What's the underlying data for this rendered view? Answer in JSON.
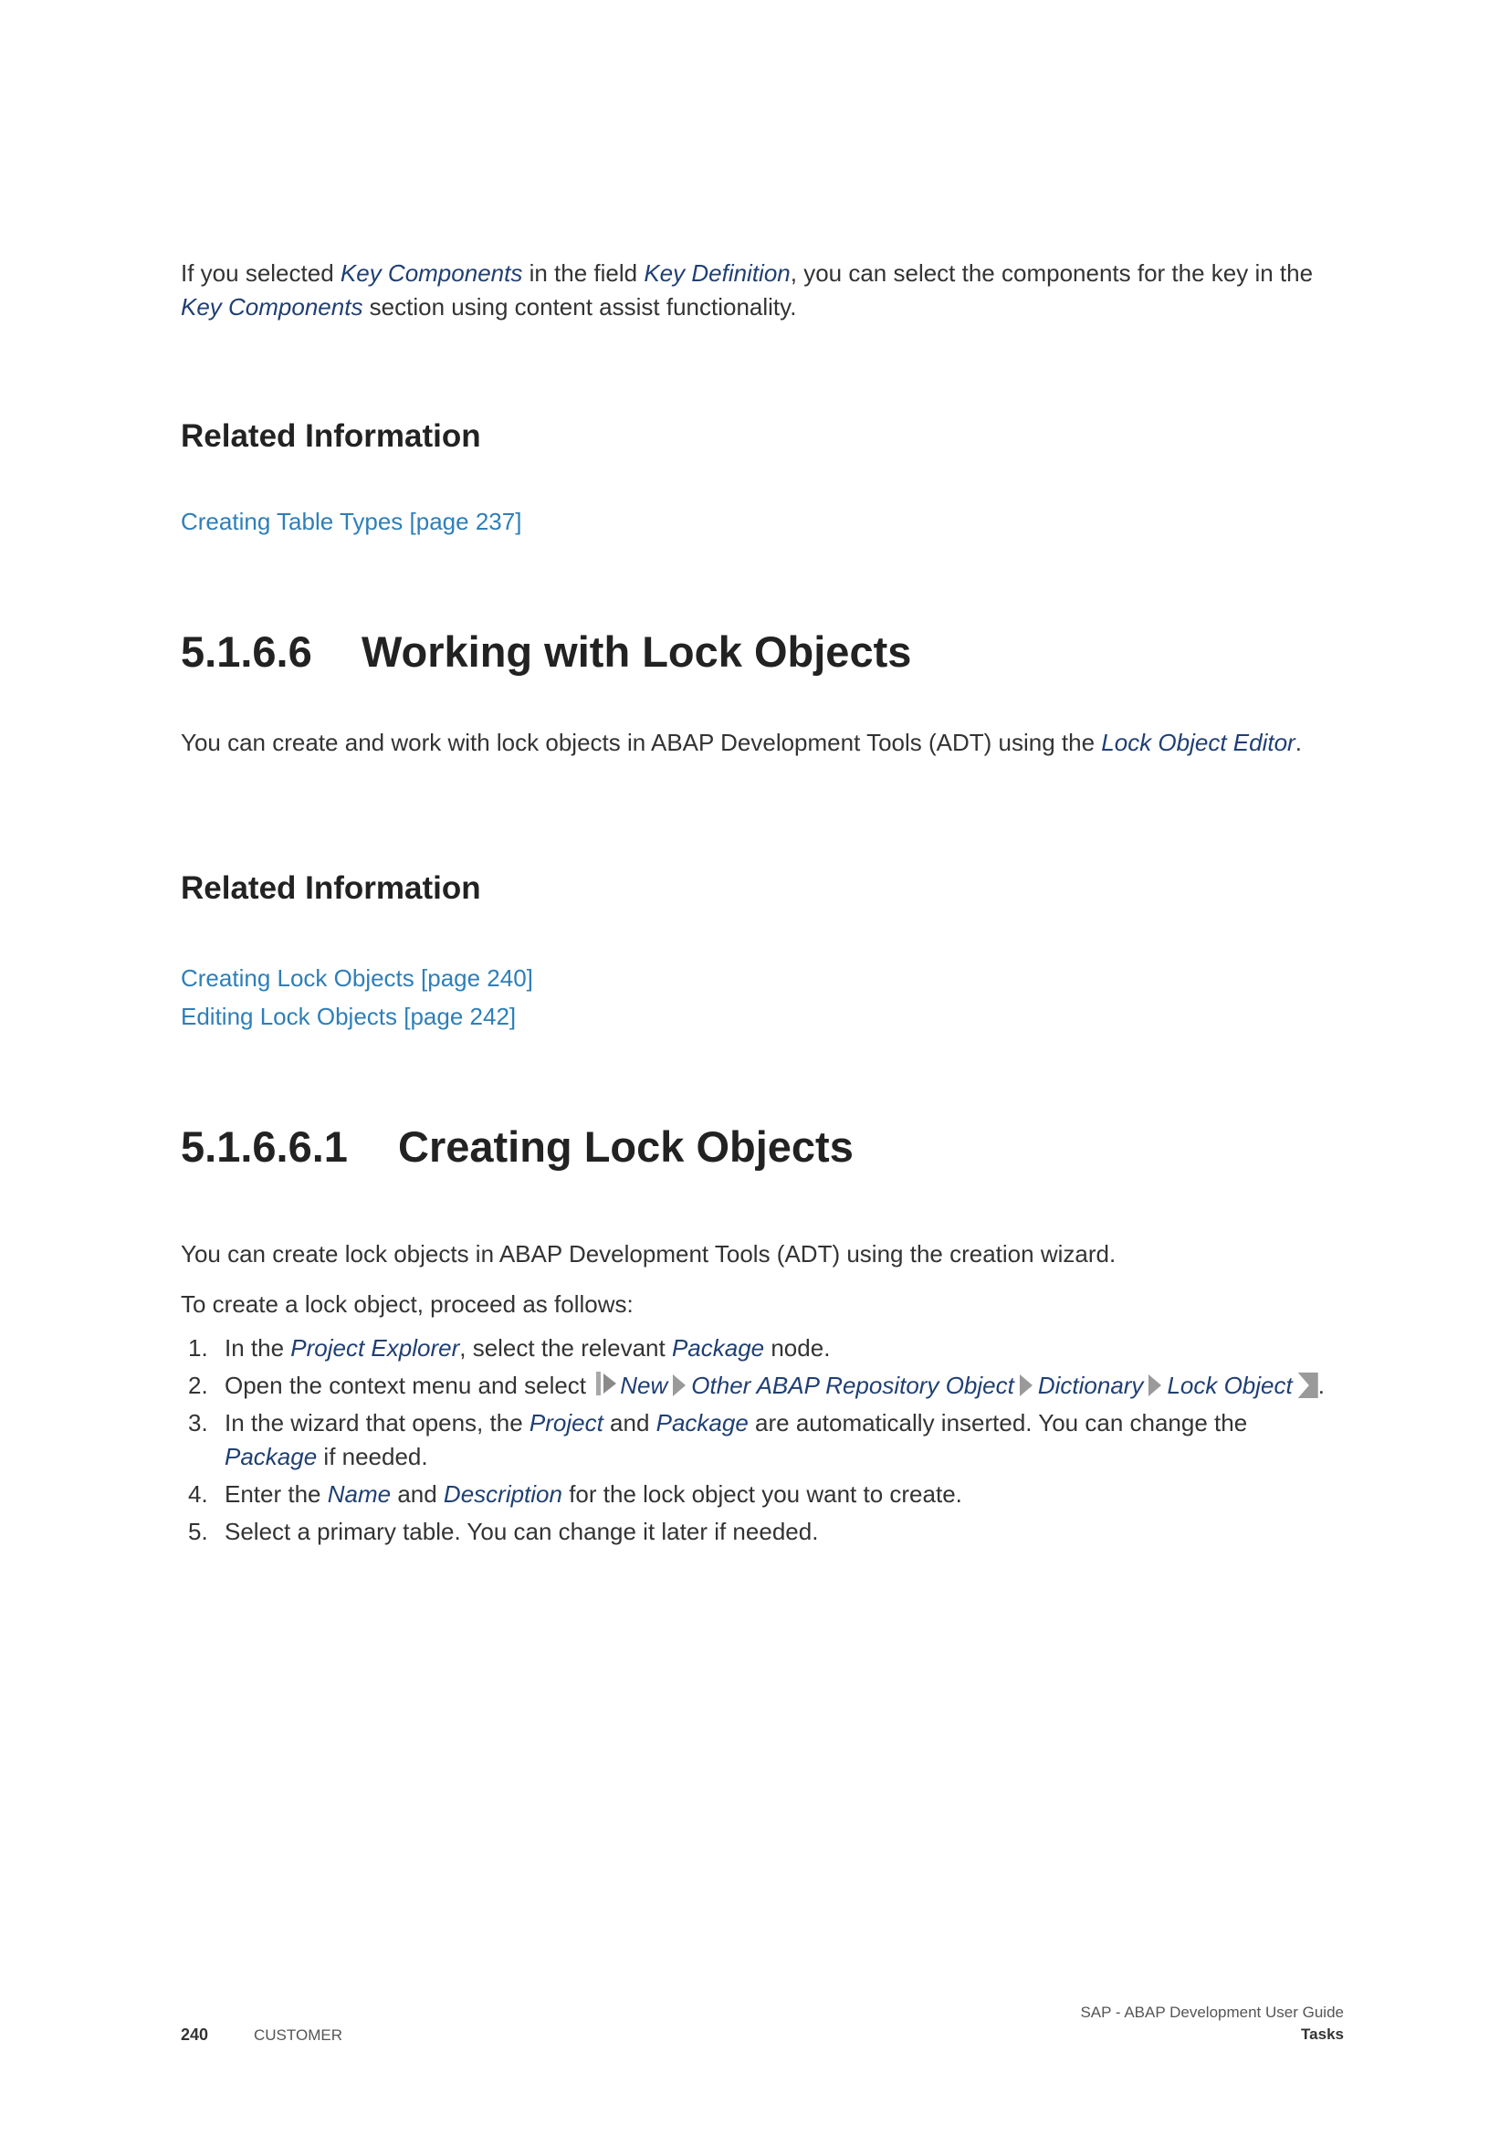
{
  "intro": {
    "t1": "If you selected ",
    "term1": "Key Components",
    "t2": " in the field ",
    "term2": "Key Definition",
    "t3": ", you can select the components for the key in the ",
    "term3": "Key Components",
    "t4": " section using content assist functionality."
  },
  "related1": {
    "heading": "Related Information",
    "links": [
      "Creating Table Types [page 237]"
    ]
  },
  "section1": {
    "number": "5.1.6.6",
    "title": "Working with Lock Objects",
    "t1": "You can create and work with lock objects in ABAP Development Tools (ADT) using the ",
    "term1": "Lock Object Editor",
    "t2": "."
  },
  "related2": {
    "heading": "Related Information",
    "links": [
      "Creating Lock Objects [page 240]",
      "Editing Lock Objects [page 242]"
    ]
  },
  "section2": {
    "number": "5.1.6.6.1",
    "title": "Creating Lock Objects",
    "p1": "You can create lock objects in ABAP Development Tools (ADT) using the creation wizard.",
    "p2": "To create a lock object, proceed as follows:",
    "steps": {
      "s1": {
        "n": "1.",
        "t1": "In the ",
        "term1": "Project Explorer",
        "t2": ", select the relevant ",
        "term2": "Package",
        "t3": " node."
      },
      "s2": {
        "n": "2.",
        "t1": "Open the context menu and select ",
        "menu": [
          "New",
          "Other ABAP Repository Object",
          "Dictionary",
          "Lock Object"
        ],
        "t2": "."
      },
      "s3": {
        "n": "3.",
        "t1": "In the wizard that opens, the ",
        "term1": "Project",
        "t2": " and ",
        "term2": "Package",
        "t3": " are automatically inserted. You can change the ",
        "term3": "Package",
        "t4": " if needed."
      },
      "s4": {
        "n": "4.",
        "t1": "Enter the ",
        "term1": "Name",
        "t2": " and ",
        "term2": "Description",
        "t3": " for the lock object you want to create."
      },
      "s5": {
        "n": "5.",
        "t1": "Select a primary table. You can change it later if needed."
      }
    }
  },
  "footer": {
    "page_number": "240",
    "label": "CUSTOMER",
    "doc_title": "SAP - ABAP Development User Guide",
    "chapter": "Tasks"
  }
}
